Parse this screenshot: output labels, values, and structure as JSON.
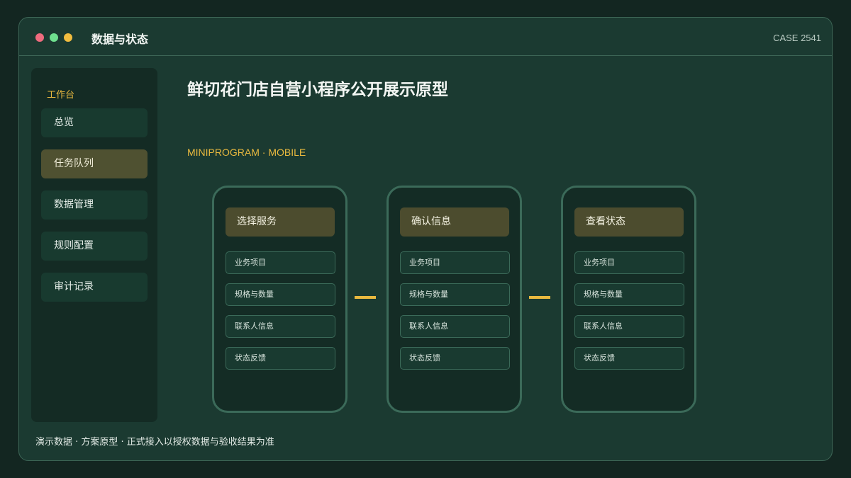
{
  "window": {
    "title": "数据与状态",
    "case_id": "CASE 2541",
    "controls": [
      "close",
      "maximize",
      "minimize"
    ]
  },
  "sidebar": {
    "heading": "工作台",
    "items": [
      {
        "label": "总览",
        "active": false
      },
      {
        "label": "任务队列",
        "active": true
      },
      {
        "label": "数据管理",
        "active": false
      },
      {
        "label": "规则配置",
        "active": false
      },
      {
        "label": "审计记录",
        "active": false
      }
    ]
  },
  "main": {
    "title": "鲜切花门店自营小程序公开展示原型",
    "subtitle": "MINIPROGRAM · MOBILE",
    "phones": [
      {
        "header": "选择服务",
        "rows": [
          "业务项目",
          "规格与数量",
          "联系人信息",
          "状态反馈"
        ]
      },
      {
        "header": "确认信息",
        "rows": [
          "业务项目",
          "规格与数量",
          "联系人信息",
          "状态反馈"
        ]
      },
      {
        "header": "查看状态",
        "rows": [
          "业务项目",
          "规格与数量",
          "联系人信息",
          "状态反馈"
        ]
      }
    ]
  },
  "footer": {
    "note": "演示数据 · 方案原型 · 正式接入以授权数据与验收结果为准"
  },
  "colors": {
    "accent": "#e9b93f",
    "dot_red": "#ef6b7e",
    "dot_green": "#6fe08f",
    "dot_yellow": "#f1bc3f",
    "active_item": "#4f5131",
    "border": "#3b6a59"
  }
}
